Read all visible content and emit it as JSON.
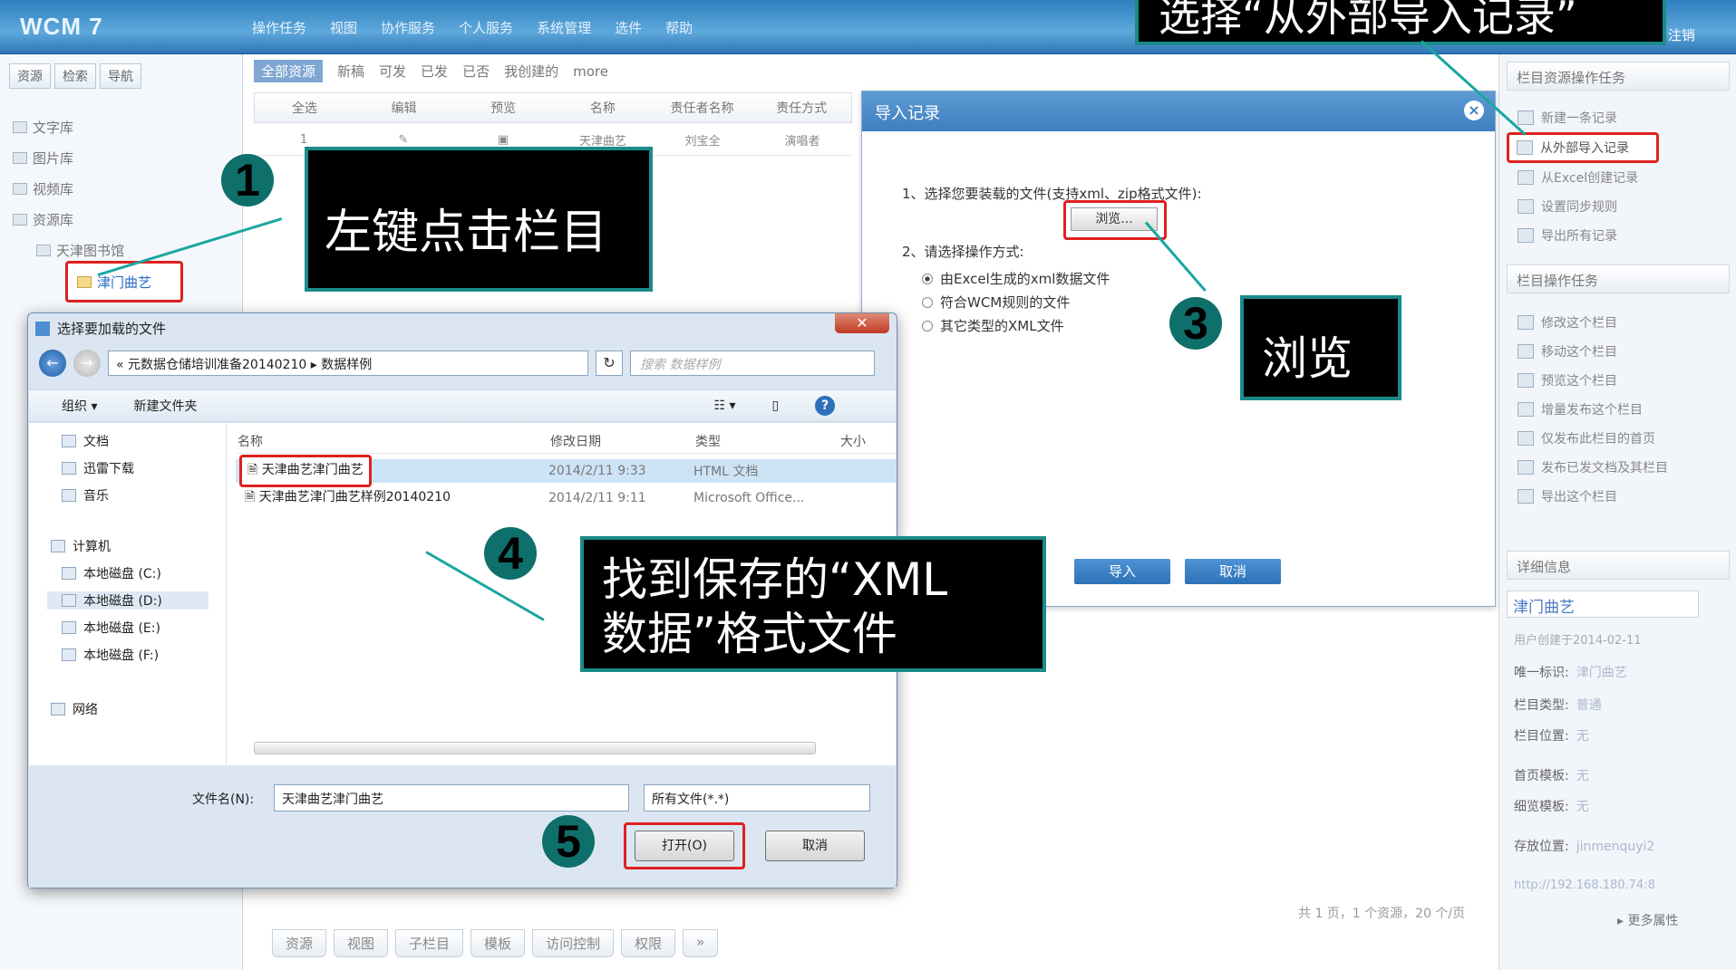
{
  "app": {
    "logo": "WCM 7",
    "menu": [
      "操作任务",
      "视图",
      "协作服务",
      "个人服务",
      "系统管理",
      "选件",
      "帮助"
    ],
    "top_right": "| 注销"
  },
  "left": {
    "tabs": [
      "资源",
      "检索",
      "导航"
    ],
    "tree": [
      "文字库",
      "图片库",
      "视频库",
      "资源库",
      "天津图书馆",
      "津门曲艺"
    ]
  },
  "middle": {
    "filters": [
      "全部资源",
      "新稿",
      "可发",
      "已发",
      "已否",
      "我创建的",
      "more"
    ],
    "columns": [
      "全选",
      "编辑",
      "预览",
      "名称",
      "责任者名称",
      "责任方式"
    ],
    "row": [
      "1",
      "",
      "",
      "天津曲艺",
      "刘宝全",
      "演唱者"
    ],
    "pager": "共 1 页，1 个资源，20 个/页",
    "bottom_tabs": [
      "资源",
      "视图",
      "子栏目",
      "模板",
      "访问控制",
      "权限",
      "»"
    ]
  },
  "right": {
    "sec1": "栏目资源操作任务",
    "sec1_items": [
      "新建一条记录",
      "从外部导入记录",
      "从Excel创建记录",
      "设置同步规则",
      "导出所有记录"
    ],
    "sec2": "栏目操作任务",
    "sec2_items": [
      "修改这个栏目",
      "移动这个栏目",
      "预览这个栏目",
      "增量发布这个栏目",
      "仅发布此栏目的首页",
      "发布已发文档及其栏目",
      "导出这个栏目"
    ],
    "sec3": "详细信息",
    "title": "津门曲艺",
    "created": "用户创建于2014-02-11",
    "unique_id_label": "唯一标识:",
    "unique_id": "津门曲艺",
    "type_label": "栏目类型:",
    "type": "普通",
    "pos_label": "栏目位置:",
    "pos": "无",
    "home_tpl_label": "首页模板:",
    "home_tpl": "无",
    "detail_tpl_label": "细览模板:",
    "detail_tpl": "无",
    "store_label": "存放位置:",
    "store": "jinmenquyi2",
    "url": "http://192.168.180.74:8",
    "more": "▸ 更多属性"
  },
  "dialog": {
    "title": "导入记录",
    "step1": "1、选择您要装载的文件(支持xml、zip格式文件):",
    "browse": "浏览...",
    "step2": "2、请选择操作方式:",
    "options": [
      "由Excel生成的xml数据文件",
      "符合WCM规则的文件",
      "其它类型的XML文件"
    ],
    "import": "导入",
    "cancel": "取消"
  },
  "file_dialog": {
    "title": "选择要加载的文件",
    "path": "« 元数据仓储培训准备20140210 ▸ 数据样例",
    "search": "搜索 数据样例",
    "organize": "组织 ▾",
    "new_folder": "新建文件夹",
    "nav": [
      "文档",
      "迅雷下载",
      "音乐",
      "计算机",
      "本地磁盘 (C:)",
      "本地磁盘 (D:)",
      "本地磁盘 (E:)",
      "本地磁盘 (F:)",
      "网络"
    ],
    "cols": [
      "名称",
      "修改日期",
      "类型",
      "大小"
    ],
    "files": [
      {
        "name": "天津曲艺津门曲艺",
        "date": "2014/2/11 9:33",
        "type": "HTML 文档"
      },
      {
        "name": "天津曲艺津门曲艺样例20140210",
        "date": "2014/2/11 9:11",
        "type": "Microsoft Office..."
      }
    ],
    "filename_label": "文件名(N):",
    "filename": "天津曲艺津门曲艺",
    "filter": "所有文件(*.*)",
    "open": "打开(O)",
    "cancel": "取消"
  },
  "callouts": {
    "c1": "左键点击栏目",
    "c2": "选择“从外部导入记录”",
    "c3": "浏览",
    "c4": "找到保存的“XML\n数据”格式文件",
    "n1": "1",
    "n3": "3",
    "n4": "4",
    "n5": "5"
  }
}
